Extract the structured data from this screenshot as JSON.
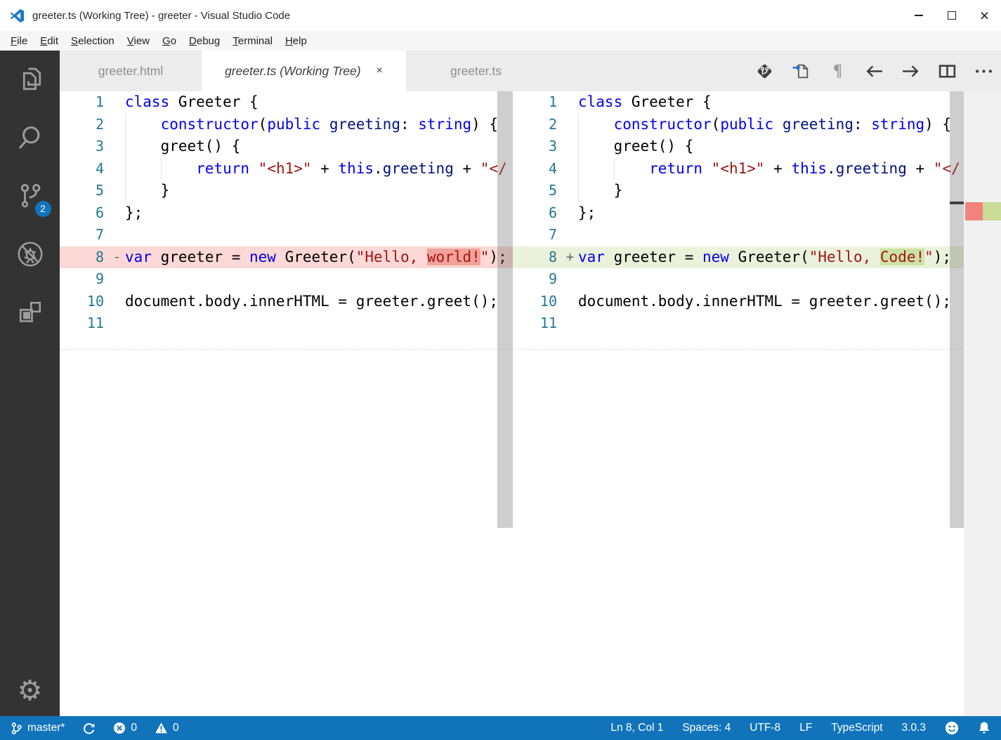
{
  "window": {
    "title": "greeter.ts (Working Tree) - greeter - Visual Studio Code",
    "controls": [
      {
        "name": "minimize",
        "glyph": "minimize"
      },
      {
        "name": "maximize",
        "glyph": "maximize"
      },
      {
        "name": "close",
        "glyph": "close"
      }
    ]
  },
  "menu": {
    "items": [
      "File",
      "Edit",
      "Selection",
      "View",
      "Go",
      "Debug",
      "Terminal",
      "Help"
    ]
  },
  "activity_bar": {
    "items": [
      {
        "name": "explorer"
      },
      {
        "name": "search"
      },
      {
        "name": "source-control",
        "badge": "2"
      },
      {
        "name": "debug"
      },
      {
        "name": "extensions"
      }
    ],
    "settings": {
      "name": "settings-gear",
      "glyph": "⚙"
    }
  },
  "tabs": {
    "close_glyph": "×",
    "items": [
      {
        "label": "greeter.html",
        "active": false
      },
      {
        "label": "greeter.ts (Working Tree)",
        "active": true,
        "closable": true
      },
      {
        "label": "greeter.ts",
        "active": false
      }
    ]
  },
  "toolbar": {
    "items": [
      {
        "name": "open-changes"
      },
      {
        "name": "open-file"
      },
      {
        "name": "toggle-whitespace",
        "glyph": "¶"
      },
      {
        "name": "previous-change"
      },
      {
        "name": "next-change"
      },
      {
        "name": "split-editor"
      },
      {
        "name": "more-actions"
      }
    ]
  },
  "diff": {
    "left_lines": [
      {
        "num": "1",
        "sign": "",
        "diff": "",
        "guides": [],
        "tokens": [
          {
            "t": "class",
            "c": "kw"
          },
          {
            "t": " Greeter {",
            "c": "pl"
          }
        ]
      },
      {
        "num": "2",
        "sign": "",
        "diff": "",
        "guides": [
          0
        ],
        "tokens": [
          {
            "t": "    ",
            "c": "pl"
          },
          {
            "t": "constructor",
            "c": "kw"
          },
          {
            "t": "(",
            "c": "pl"
          },
          {
            "t": "public",
            "c": "kw"
          },
          {
            "t": " ",
            "c": "pl"
          },
          {
            "t": "greeting",
            "c": "var"
          },
          {
            "t": ": ",
            "c": "pl"
          },
          {
            "t": "string",
            "c": "kw"
          },
          {
            "t": ") {",
            "c": "pl"
          }
        ]
      },
      {
        "num": "3",
        "sign": "",
        "diff": "",
        "guides": [
          0
        ],
        "tokens": [
          {
            "t": "    greet() {",
            "c": "pl"
          }
        ]
      },
      {
        "num": "4",
        "sign": "",
        "diff": "",
        "guides": [
          0,
          4
        ],
        "tokens": [
          {
            "t": "        ",
            "c": "pl"
          },
          {
            "t": "return",
            "c": "kw"
          },
          {
            "t": " ",
            "c": "pl"
          },
          {
            "t": "\"<h1>\"",
            "c": "str"
          },
          {
            "t": " + ",
            "c": "pl"
          },
          {
            "t": "this",
            "c": "kw"
          },
          {
            "t": ".",
            "c": "pl"
          },
          {
            "t": "greeting",
            "c": "var"
          },
          {
            "t": " + ",
            "c": "pl"
          },
          {
            "t": "\"</",
            "c": "str"
          }
        ]
      },
      {
        "num": "5",
        "sign": "",
        "diff": "",
        "guides": [
          0
        ],
        "tokens": [
          {
            "t": "    }",
            "c": "pl"
          }
        ]
      },
      {
        "num": "6",
        "sign": "",
        "diff": "",
        "guides": [],
        "tokens": [
          {
            "t": "};",
            "c": "pl"
          }
        ]
      },
      {
        "num": "7",
        "sign": "",
        "diff": "",
        "guides": [],
        "tokens": []
      },
      {
        "num": "8",
        "sign": "-",
        "diff": "del",
        "guides": [],
        "tokens": [
          {
            "t": "var",
            "c": "kw"
          },
          {
            "t": " greeter = ",
            "c": "pl"
          },
          {
            "t": "new",
            "c": "kw"
          },
          {
            "t": " Greeter(",
            "c": "pl"
          },
          {
            "t": "\"Hello, ",
            "c": "str"
          },
          {
            "t": "world!",
            "c": "str",
            "hl": true
          },
          {
            "t": "\"",
            "c": "str"
          },
          {
            "t": ");",
            "c": "pl"
          }
        ]
      },
      {
        "num": "9",
        "sign": "",
        "diff": "",
        "guides": [],
        "tokens": []
      },
      {
        "num": "10",
        "sign": "",
        "diff": "",
        "guides": [],
        "tokens": [
          {
            "t": "document.body.innerHTML = greeter.greet();",
            "c": "pl"
          }
        ]
      },
      {
        "num": "11",
        "sign": "",
        "diff": "",
        "guides": [],
        "tokens": []
      }
    ],
    "right_lines": [
      {
        "num": "1",
        "sign": "",
        "diff": "",
        "guides": [],
        "tokens": [
          {
            "t": "class",
            "c": "kw"
          },
          {
            "t": " Greeter {",
            "c": "pl"
          }
        ]
      },
      {
        "num": "2",
        "sign": "",
        "diff": "",
        "guides": [
          0
        ],
        "tokens": [
          {
            "t": "    ",
            "c": "pl"
          },
          {
            "t": "constructor",
            "c": "kw"
          },
          {
            "t": "(",
            "c": "pl"
          },
          {
            "t": "public",
            "c": "kw"
          },
          {
            "t": " ",
            "c": "pl"
          },
          {
            "t": "greeting",
            "c": "var"
          },
          {
            "t": ": ",
            "c": "pl"
          },
          {
            "t": "string",
            "c": "kw"
          },
          {
            "t": ") {",
            "c": "pl"
          }
        ]
      },
      {
        "num": "3",
        "sign": "",
        "diff": "",
        "guides": [
          0
        ],
        "tokens": [
          {
            "t": "    greet() {",
            "c": "pl"
          }
        ]
      },
      {
        "num": "4",
        "sign": "",
        "diff": "",
        "guides": [
          0,
          4
        ],
        "tokens": [
          {
            "t": "        ",
            "c": "pl"
          },
          {
            "t": "return",
            "c": "kw"
          },
          {
            "t": " ",
            "c": "pl"
          },
          {
            "t": "\"<h1>\"",
            "c": "str"
          },
          {
            "t": " + ",
            "c": "pl"
          },
          {
            "t": "this",
            "c": "kw"
          },
          {
            "t": ".",
            "c": "pl"
          },
          {
            "t": "greeting",
            "c": "var"
          },
          {
            "t": " + ",
            "c": "pl"
          },
          {
            "t": "\"</",
            "c": "str"
          }
        ]
      },
      {
        "num": "5",
        "sign": "",
        "diff": "",
        "guides": [
          0
        ],
        "tokens": [
          {
            "t": "    }",
            "c": "pl"
          }
        ]
      },
      {
        "num": "6",
        "sign": "",
        "diff": "",
        "guides": [],
        "tokens": [
          {
            "t": "};",
            "c": "pl"
          }
        ]
      },
      {
        "num": "7",
        "sign": "",
        "diff": "",
        "guides": [],
        "tokens": []
      },
      {
        "num": "8",
        "sign": "+",
        "diff": "add",
        "guides": [],
        "tokens": [
          {
            "t": "var",
            "c": "kw"
          },
          {
            "t": " greeter = ",
            "c": "pl"
          },
          {
            "t": "new",
            "c": "kw"
          },
          {
            "t": " Greeter(",
            "c": "pl"
          },
          {
            "t": "\"Hello, ",
            "c": "str"
          },
          {
            "t": "Code!",
            "c": "str",
            "hl": true
          },
          {
            "t": "\"",
            "c": "str"
          },
          {
            "t": ");",
            "c": "pl"
          }
        ]
      },
      {
        "num": "9",
        "sign": "",
        "diff": "",
        "guides": [],
        "tokens": []
      },
      {
        "num": "10",
        "sign": "",
        "diff": "",
        "guides": [],
        "tokens": [
          {
            "t": "document.body.innerHTML = greeter.greet();",
            "c": "pl"
          }
        ]
      },
      {
        "num": "11",
        "sign": "",
        "diff": "",
        "guides": [],
        "tokens": []
      }
    ]
  },
  "status_bar": {
    "left": [
      {
        "icon": "git-branch",
        "label": "master*"
      },
      {
        "icon": "sync",
        "label": ""
      },
      {
        "icon": "errors",
        "label": "0"
      },
      {
        "icon": "warnings",
        "label": "0"
      }
    ],
    "right": [
      {
        "label": "Ln 8, Col 1"
      },
      {
        "label": "Spaces: 4"
      },
      {
        "label": "UTF-8"
      },
      {
        "label": "LF"
      },
      {
        "label": "TypeScript"
      },
      {
        "label": "3.0.3"
      },
      {
        "icon": "feedback-smiley"
      },
      {
        "icon": "notifications-bell"
      }
    ]
  },
  "colors": {
    "accent": "#1174bb",
    "activity_bar_bg": "#333333",
    "removed_line_bg": "#fcd8d6",
    "removed_char_bg": "#f2a29b",
    "added_line_bg": "#eaf2dc",
    "added_char_bg": "#cde2a5",
    "ruler_removed": "#f2837c",
    "ruler_added": "#c9db97",
    "keyword": "#0000ee",
    "string": "#a31515",
    "line_number": "#237893"
  }
}
